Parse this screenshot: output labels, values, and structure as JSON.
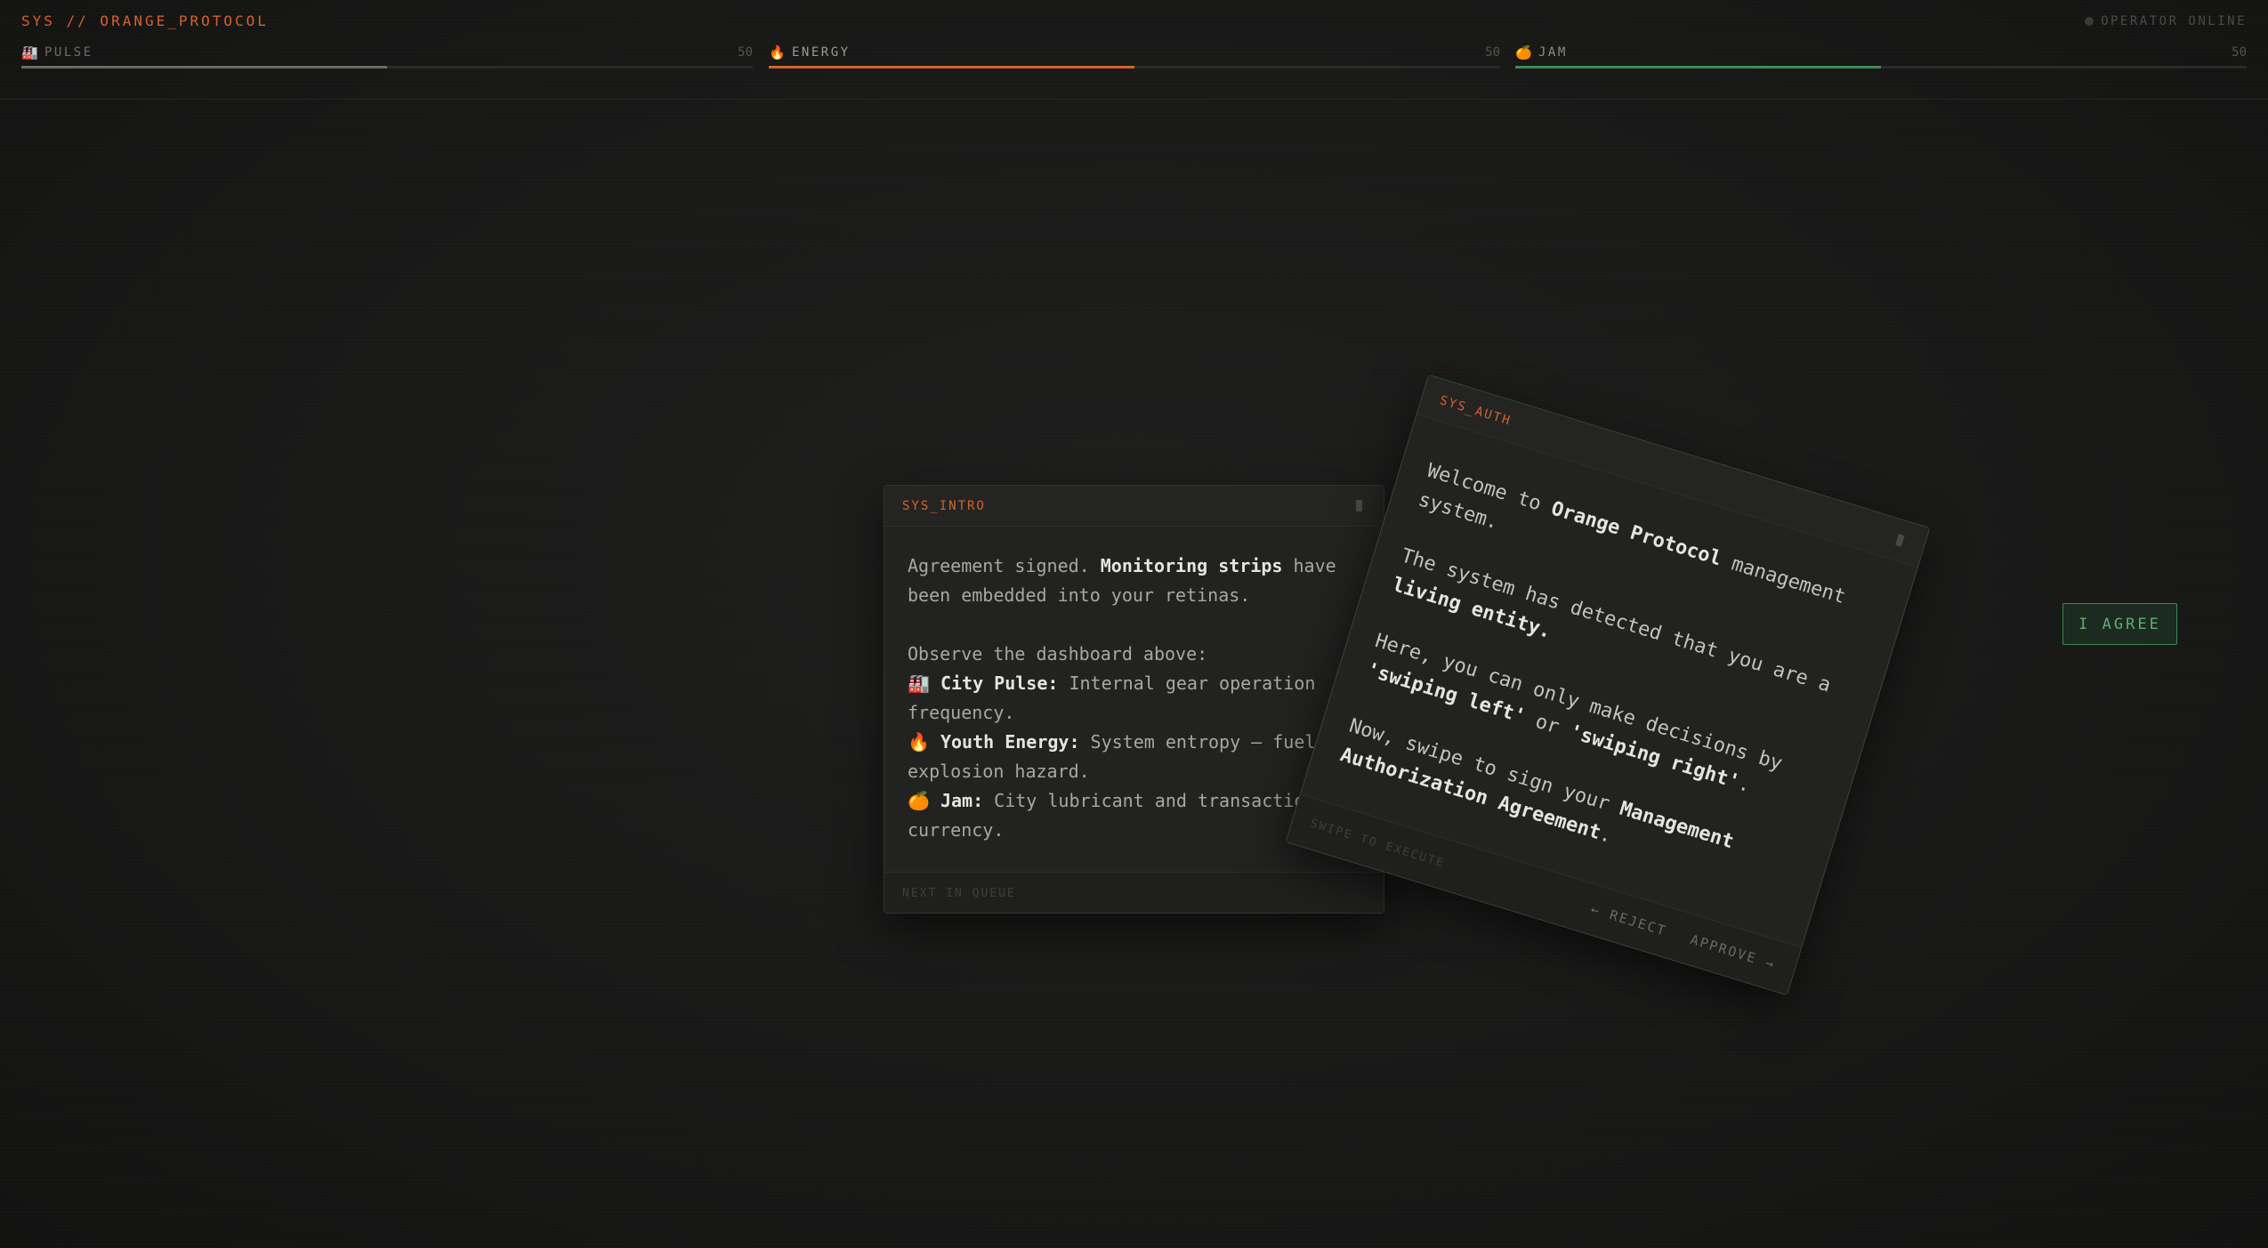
{
  "header": {
    "title": "SYS // ORANGE_PROTOCOL",
    "status": "OPERATOR ONLINE",
    "meters": [
      {
        "icon": "factory-icon",
        "glyph": "🏭",
        "label": "PULSE",
        "value": "50",
        "level": 0.5,
        "color": "#6a6963"
      },
      {
        "icon": "fire-icon",
        "glyph": "🔥",
        "label": "ENERGY",
        "value": "50",
        "level": 0.5,
        "color": "#d4632a"
      },
      {
        "icon": "orange-icon",
        "glyph": "🍊",
        "label": "JAM",
        "value": "50",
        "level": 0.5,
        "color": "#3e8a54"
      }
    ]
  },
  "intro_card": {
    "tag": "SYS_INTRO",
    "line1_a": "Agreement signed. ",
    "line1_b": "Monitoring strips",
    "line1_c": " have been embedded into your retinas.",
    "observe": "Observe the dashboard above:",
    "item1_icon": "🏭",
    "item1_name": "City Pulse:",
    "item1_desc": " Internal gear operation frequency.",
    "item2_icon": "🔥",
    "item2_name": "Youth Energy:",
    "item2_desc": " System entropy — fuel and explosion hazard.",
    "item3_icon": "🍊",
    "item3_name": "Jam:",
    "item3_desc": " City lubricant and transaction currency.",
    "footer_hint": "NEXT IN QUEUE"
  },
  "auth_card": {
    "tag": "SYS_AUTH",
    "p1_a": "Welcome to ",
    "p1_b": "Orange Protocol",
    "p1_c": " management system.",
    "p2_a": "The system has detected that you are a ",
    "p2_b": "living entity.",
    "p3_a": "Here, you can only make decisions by ",
    "p3_b": "'swiping left'",
    "p3_c": " or ",
    "p3_d": "'swiping right'",
    "p3_e": ".",
    "p4_a": "Now, swipe to sign your ",
    "p4_b": "Management Authorization Agreement",
    "p4_c": ".",
    "footer_hint": "SWIPE TO EXECUTE",
    "reject_label": "← REJECT",
    "approve_label": "APPROVE →"
  },
  "agree_button": {
    "label": "I AGREE",
    "color": "#3e8a54"
  }
}
